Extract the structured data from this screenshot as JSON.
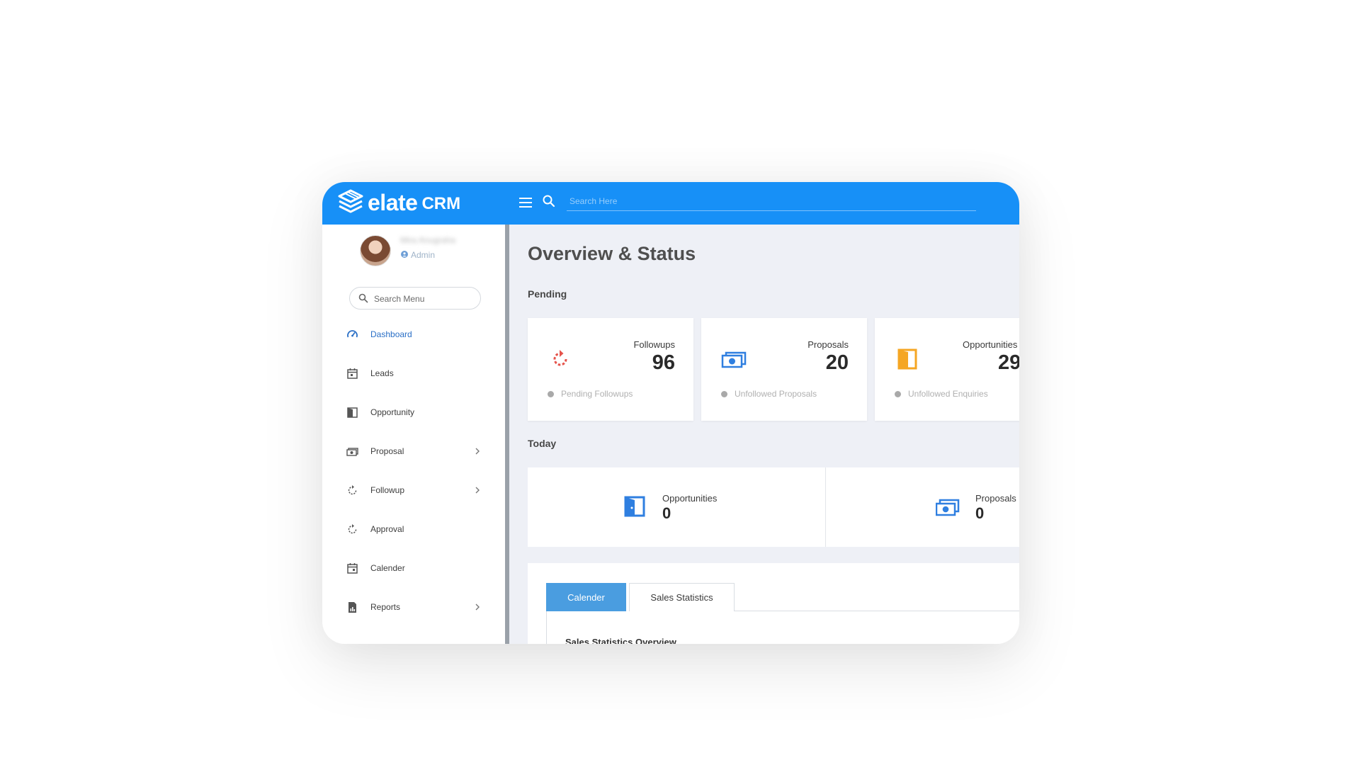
{
  "header": {
    "brand": "elate",
    "brand_suffix": "CRM",
    "search_placeholder": "Search Here"
  },
  "user": {
    "name": "Mira Anugraha",
    "role": "Admin"
  },
  "sidebar": {
    "search_placeholder": "Search Menu",
    "items": [
      {
        "label": "Dashboard",
        "icon": "dashboard-icon",
        "active": true
      },
      {
        "label": "Leads",
        "icon": "calendar-icon"
      },
      {
        "label": "Opportunity",
        "icon": "door-icon"
      },
      {
        "label": "Proposal",
        "icon": "money-icon",
        "has_children": true
      },
      {
        "label": "Followup",
        "icon": "refresh-icon",
        "has_children": true
      },
      {
        "label": "Approval",
        "icon": "refresh-icon"
      },
      {
        "label": "Calender",
        "icon": "calendar-icon"
      },
      {
        "label": "Reports",
        "icon": "report-icon",
        "has_children": true
      }
    ]
  },
  "main": {
    "title": "Overview & Status",
    "pending": {
      "title": "Pending",
      "cards": [
        {
          "label": "Followups",
          "value": "96",
          "footer": "Pending Followups",
          "icon": "refresh-icon",
          "color": "#e5534b"
        },
        {
          "label": "Proposals",
          "value": "20",
          "footer": "Unfollowed Proposals",
          "icon": "money-icon",
          "color": "#2f7fe0"
        },
        {
          "label": "Opportunities",
          "value": "29",
          "footer": "Unfollowed Enquiries",
          "icon": "door-icon",
          "color": "#f5a623"
        }
      ]
    },
    "today": {
      "title": "Today",
      "items": [
        {
          "label": "Opportunities",
          "value": "0",
          "icon": "door-icon"
        },
        {
          "label": "Proposals",
          "value": "0",
          "icon": "money-icon"
        }
      ]
    },
    "tabs": [
      {
        "label": "Calender",
        "active": true
      },
      {
        "label": "Sales Statistics",
        "active": false
      }
    ],
    "tab_content_heading": "Sales Statistics Overview"
  },
  "colors": {
    "brand": "#1790f7",
    "background": "#eef0f6",
    "tab_active": "#4a9de0"
  }
}
